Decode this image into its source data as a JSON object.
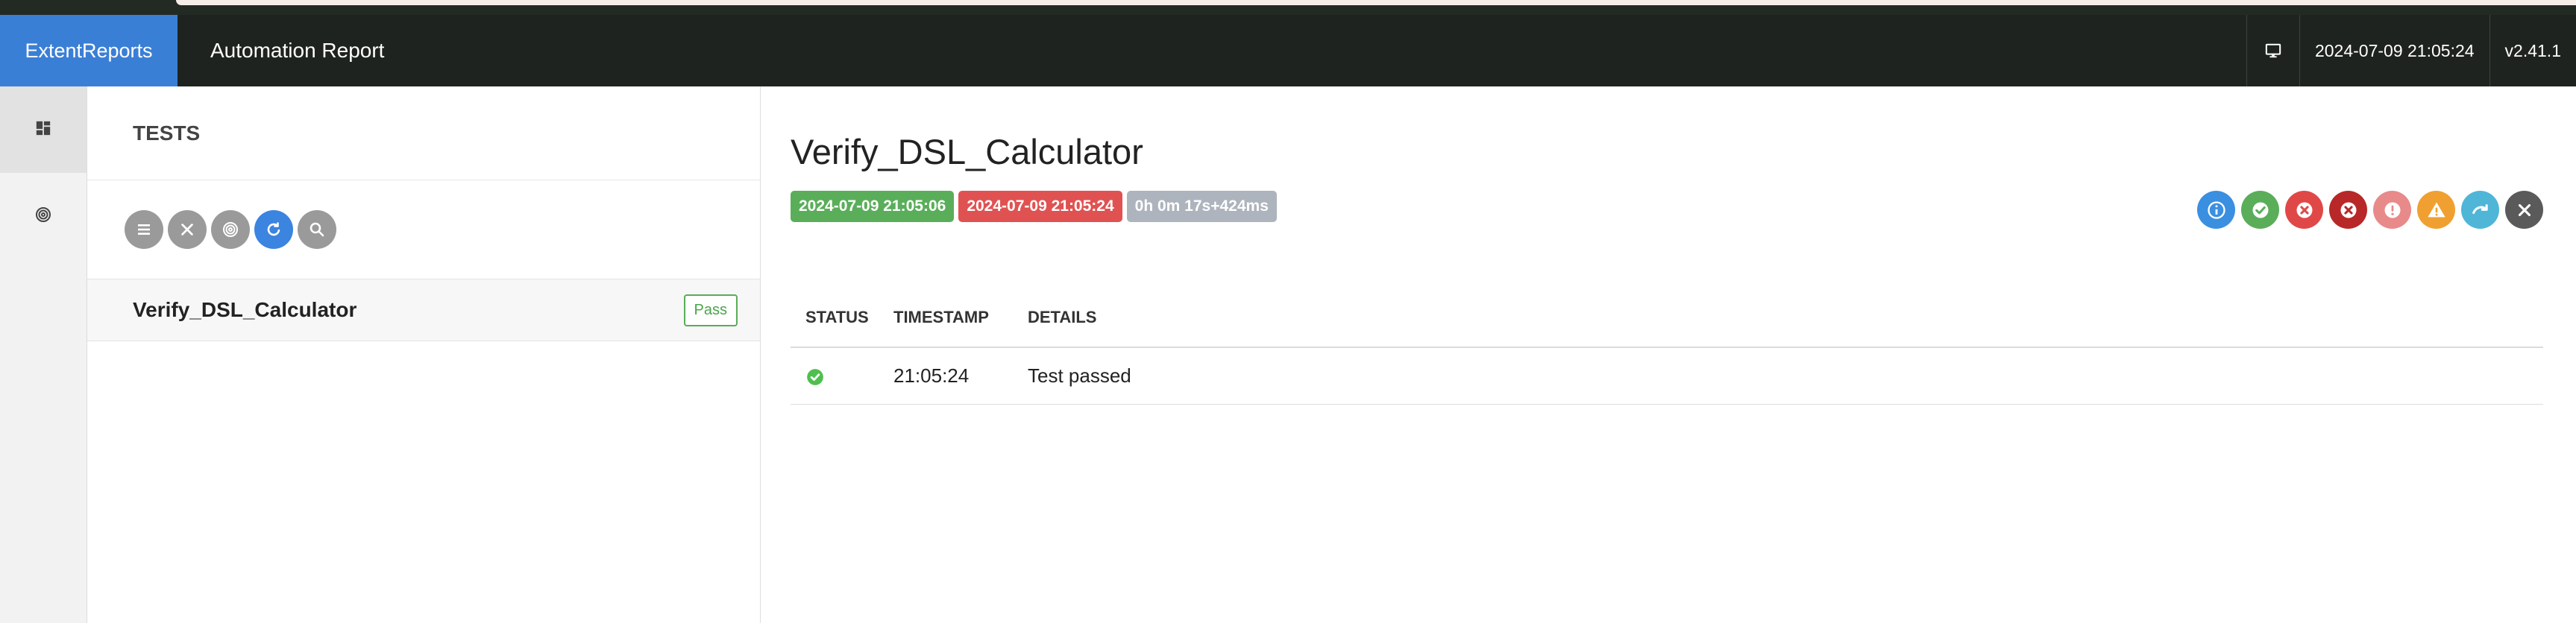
{
  "navbar": {
    "brand": "ExtentReports",
    "title": "Automation Report",
    "datetime": "2024-07-09 21:05:24",
    "version": "v2.41.1",
    "monitor_icon": "monitor-icon"
  },
  "sidenav": {
    "items": [
      {
        "icon": "dashboard-grid-icon",
        "active": true
      },
      {
        "icon": "fingerprint-icon",
        "active": false
      }
    ]
  },
  "tests_panel": {
    "header": "TESTS",
    "tools": [
      "list-icon",
      "close-icon",
      "fingerprint-icon",
      "refresh-icon",
      "search-icon"
    ],
    "tests": [
      {
        "name": "Verify_DSL_Calculator",
        "status": "Pass"
      }
    ]
  },
  "detail": {
    "title": "Verify_DSL_Calculator",
    "start_time": "2024-07-09 21:05:06",
    "end_time": "2024-07-09 21:05:24",
    "duration": "0h 0m 17s+424ms",
    "filters": [
      {
        "icon": "info-icon",
        "color": "#3b8fe0"
      },
      {
        "icon": "pass-icon",
        "color": "#5aae5a"
      },
      {
        "icon": "fail-icon",
        "color": "#e04848"
      },
      {
        "icon": "fatal-icon",
        "color": "#b82828"
      },
      {
        "icon": "error-icon",
        "color": "#e88a8a"
      },
      {
        "icon": "warning-icon",
        "color": "#f0a030"
      },
      {
        "icon": "skip-icon",
        "color": "#4fb6d8"
      },
      {
        "icon": "clear-icon",
        "color": "#5a5a5a"
      }
    ],
    "log": {
      "columns": [
        "STATUS",
        "TIMESTAMP",
        "DETAILS"
      ],
      "rows": [
        {
          "status": "pass",
          "timestamp": "21:05:24",
          "details": "Test passed"
        }
      ]
    }
  }
}
